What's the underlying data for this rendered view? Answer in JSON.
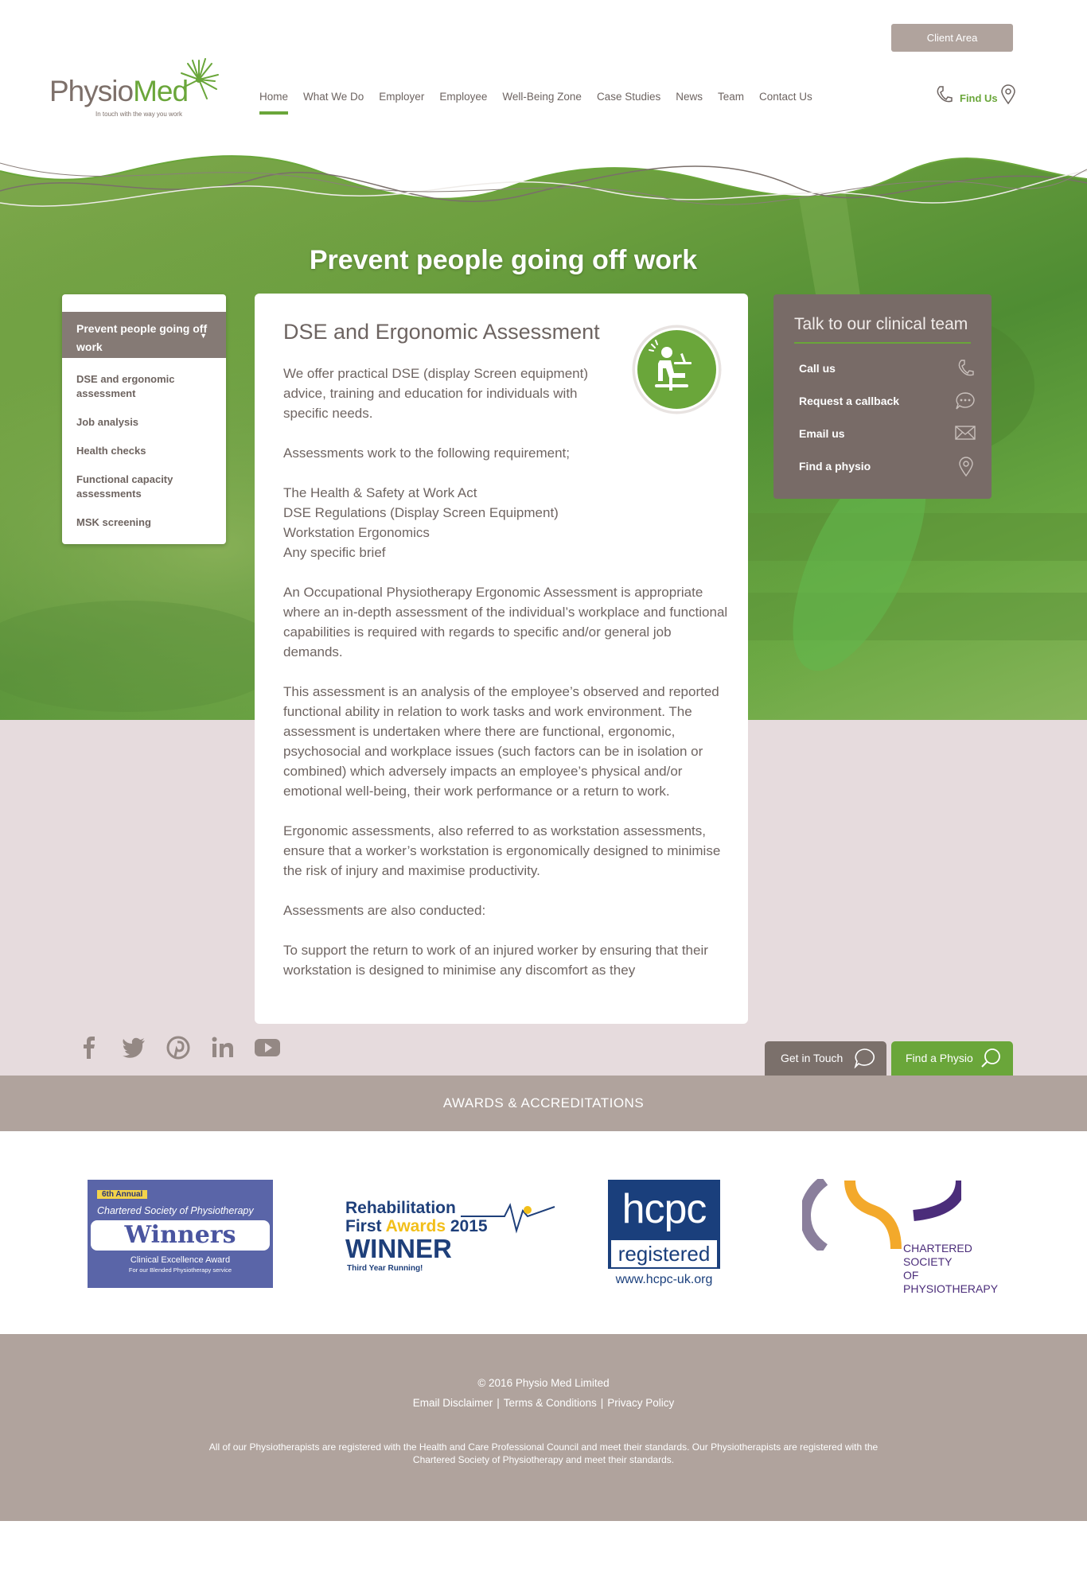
{
  "header": {
    "client_area": "Client Area",
    "logo": {
      "brand_part1": "Physio",
      "brand_part2": "Med",
      "tagline": "In touch with the way you work"
    },
    "nav": [
      "Home",
      "What We Do",
      "Employer",
      "Employee",
      "Well-Being Zone",
      "Case Studies",
      "News",
      "Team",
      "Contact Us"
    ],
    "active_nav": "Home",
    "find_us": "Find Us"
  },
  "hero": {
    "title": "Prevent people going off work"
  },
  "sidebar": {
    "heading": "Prevent people going off work",
    "items": [
      "DSE and ergonomic assessment",
      "Job analysis",
      "Health checks",
      "Functional capacity assessments",
      "MSK screening"
    ]
  },
  "content": {
    "title": "DSE and Ergonomic Assessment",
    "intro": "We offer practical DSE (display Screen equipment) advice, training and education for individuals with specific needs.",
    "requirement_intro": "Assessments work to the following requirement;",
    "requirements": [
      "The Health & Safety at Work Act",
      "DSE Regulations (Display Screen Equipment)",
      "Workstation Ergonomics",
      "Any specific brief"
    ],
    "para1": "An Occupational Physiotherapy Ergonomic Assessment is appropriate where an in-depth assessment of the individual’s workplace and functional capabilities is required with regards to specific and/or general job demands.",
    "para2": "This assessment is an analysis of the employee’s observed and reported functional ability in relation to work tasks and work environment. The assessment is undertaken where there are functional, ergonomic, psychosocial and workplace issues (such factors can be in isolation or combined) which adversely impacts an employee’s physical and/or emotional well-being, their work performance or a return to work.",
    "para3": "Ergonomic assessments, also referred to as workstation assessments, ensure that a worker’s workstation is ergonomically designed to minimise the risk of injury and maximise productivity.",
    "para4": "Assessments are also conducted:",
    "para5": "To support the return to work of an injured worker by ensuring that their workstation is designed to minimise any discomfort as they"
  },
  "talk": {
    "title": "Talk to our clinical team",
    "items": [
      "Call us",
      "Request a callback",
      "Email us",
      "Find a physio"
    ]
  },
  "cta": {
    "get_in_touch": "Get in Touch",
    "find_physio": "Find a Physio"
  },
  "awards": {
    "heading": "AWARDS & ACCREDITATIONS",
    "csp": {
      "annual": "6th Annual",
      "society": "Chartered Society of Physiotherapy",
      "winners": "Winners",
      "award": "Clinical Excellence Award",
      "sub": "For our Blended Physiotherapy service"
    },
    "rehab": {
      "line1": "Rehabilitation",
      "line2a": "First ",
      "line2b": "Awards",
      "line2c": " 2015",
      "winner": "WINNER",
      "sub": "Third Year Running!"
    },
    "hcpc": {
      "name": "hcpc",
      "registered": "registered",
      "url": "www.hcpc-uk.org"
    },
    "chartered": {
      "l1": "CHARTERED",
      "l2": "SOCIETY",
      "l3": "OF",
      "l4": "PHYSIOTHERAPY"
    }
  },
  "footer": {
    "copyright": "© 2016 Physio Med Limited",
    "links": [
      "Email Disclaimer",
      "Terms & Conditions",
      "Privacy Policy"
    ],
    "disclaimer": "All of our Physiotherapists are registered with the Health and Care Professional Council and meet their standards. Our Physiotherapists are registered with the Chartered Society of Physiotherapy and meet their standards."
  },
  "colors": {
    "brand_green": "#6aa63a",
    "taupe": "#b0a39d",
    "dark_taupe": "#786b67",
    "pink_band": "#e6dbdd"
  }
}
